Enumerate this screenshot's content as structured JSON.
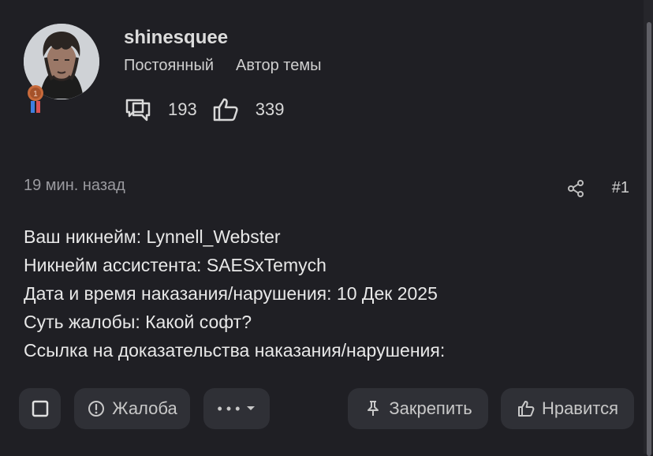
{
  "author": {
    "username": "shinesquee",
    "roles": [
      "Постоянный",
      "Автор темы"
    ],
    "stats": {
      "messages": "193",
      "reactions": "339"
    }
  },
  "post": {
    "time": "19 мин. назад",
    "number": "#1",
    "lines": [
      "Ваш никнейм: Lynnell_Webster",
      "Никнейм ассистента: SAESxTemych",
      "Дата и время наказания/нарушения: 10 Дек 2025",
      "Суть жалобы: Какой софт?",
      "Ссылка на доказательства наказания/нарушения:"
    ]
  },
  "actions": {
    "report": "Жалоба",
    "more": "• • •",
    "pin": "Закрепить",
    "like": "Нравится"
  },
  "icons": {
    "messages": "message-icon",
    "reactions": "thumbs-up-icon",
    "share": "share-icon",
    "report": "alert-circle-icon",
    "pin": "pin-icon",
    "like": "thumbs-up-icon"
  },
  "colors": {
    "background": "#1f1f24",
    "button": "#2f3036",
    "text": "#e6e6e6",
    "muted": "#9a9a9f",
    "medal": "#c86a3b"
  }
}
